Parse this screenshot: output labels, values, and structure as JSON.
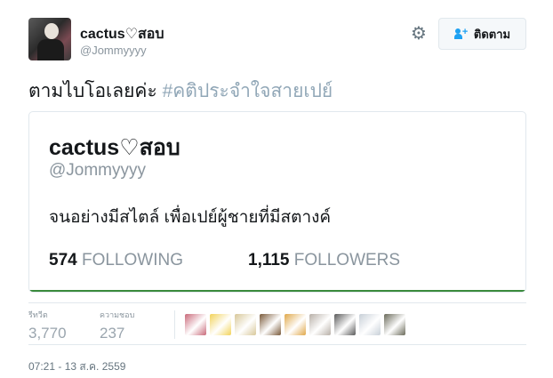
{
  "author": {
    "name": "cactus♡สอบ",
    "handle": "@Jommyyyy"
  },
  "follow_button": {
    "label": "ติดตาม",
    "icon": "person-add-icon"
  },
  "settings_icon": "gear-icon",
  "tweet": {
    "text": "ตามไบโอเลยค่ะ ",
    "hashtag": "#คติประจำใจสายเปย์"
  },
  "profile_card": {
    "name": "cactus♡สอบ",
    "handle": "@Jommyyyy",
    "bio": "จนอย่างมีสไตล์ เพื่อเปย์ผู้ชายที่มีสตางค์",
    "following_count": "574",
    "following_label": "FOLLOWING",
    "followers_count": "1,115",
    "followers_label": "FOLLOWERS",
    "accent_color": "#3a8a3c"
  },
  "engagement": {
    "retweets_label": "รีทวีต",
    "retweets_value": "3,770",
    "likes_label": "ความชอบ",
    "likes_value": "237",
    "liker_avatars": [
      {
        "color": "#c96a7a"
      },
      {
        "color": "#f2d35a"
      },
      {
        "color": "#d8c89a"
      },
      {
        "color": "#7a5a3a"
      },
      {
        "color": "#e0a84a"
      },
      {
        "color": "#b8b0a8"
      },
      {
        "color": "#5a5a5a"
      },
      {
        "color": "#c8d0d8"
      },
      {
        "color": "#6a6a5a"
      }
    ]
  },
  "timestamp": "07:21 - 13 ส.ค. 2559"
}
